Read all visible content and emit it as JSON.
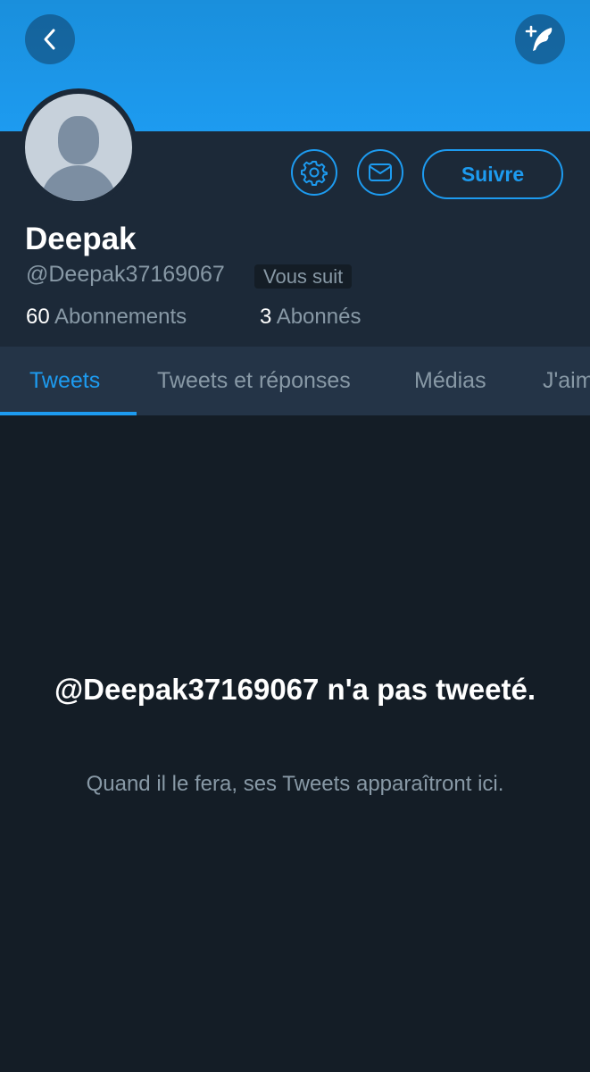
{
  "header": {
    "back_icon": "chevron-left-icon",
    "compose_icon": "compose-quill-icon",
    "banner_color": "#1d9bf0"
  },
  "profile": {
    "name": "Deepak",
    "handle": "@Deepak37169067",
    "follows_you_badge": "Vous suit",
    "follow_button": "Suivre",
    "settings_icon": "gear-icon",
    "message_icon": "envelope-icon",
    "stats": {
      "following_count": "60",
      "following_label": "Abonnements",
      "followers_count": "3",
      "followers_label": "Abonnés"
    }
  },
  "tabs": [
    {
      "label": "Tweets",
      "active": true
    },
    {
      "label": "Tweets et réponses",
      "active": false
    },
    {
      "label": "Médias",
      "active": false
    },
    {
      "label": "J'aime",
      "active": false
    }
  ],
  "empty_state": {
    "title": "@Deepak37169067 n'a pas tweeté.",
    "subtitle": "Quand il le fera, ses Tweets apparaîtront ici."
  },
  "colors": {
    "accent": "#1d9bf0",
    "background": "#141d26",
    "panel": "#1c2938",
    "tabbar": "#243447",
    "muted_text": "#8899a6"
  }
}
